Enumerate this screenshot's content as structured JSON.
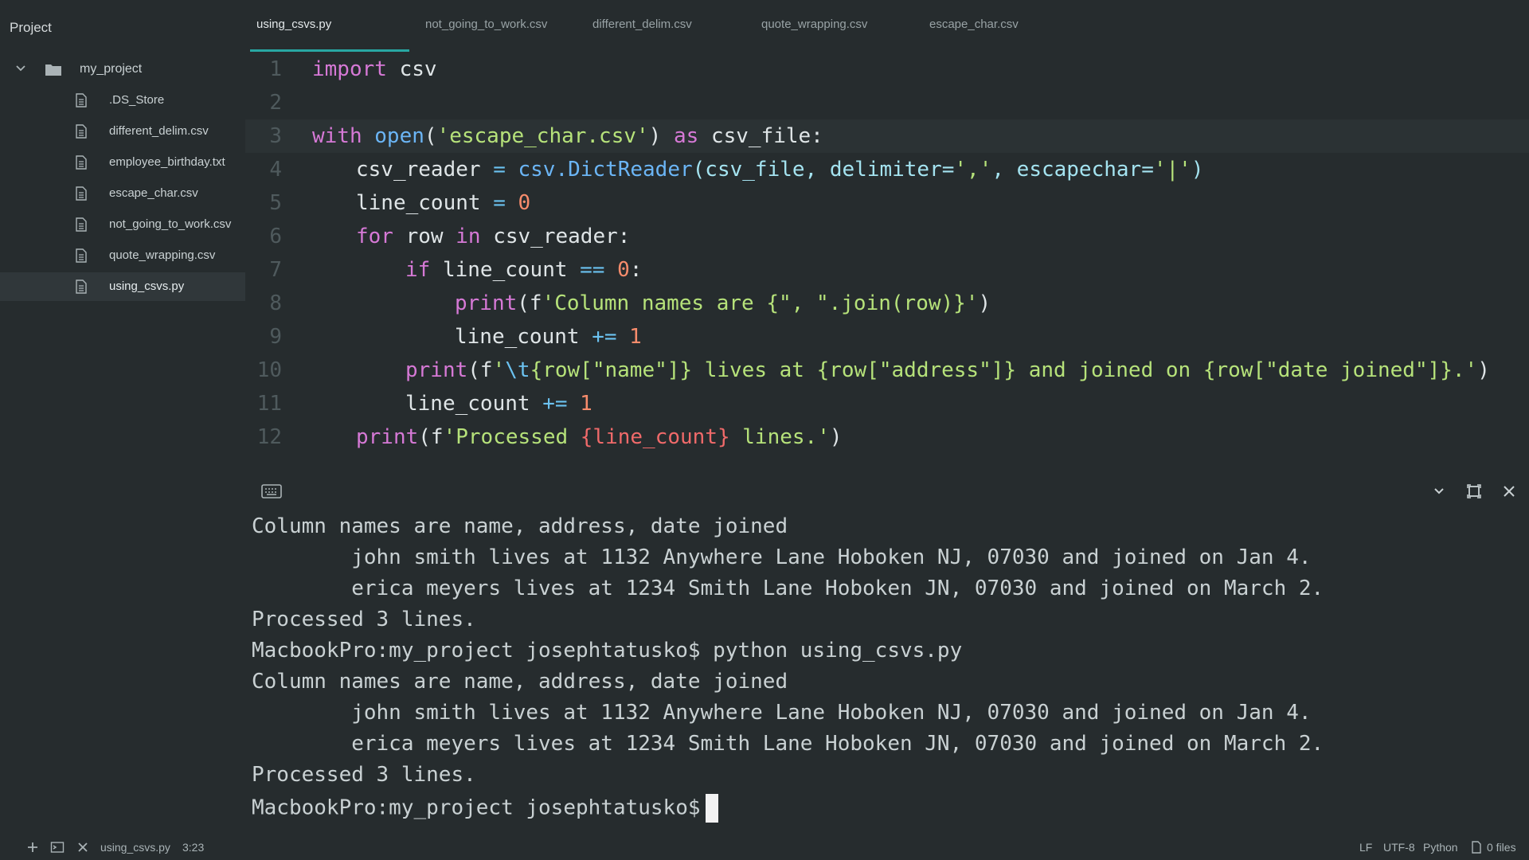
{
  "sidebar": {
    "title": "Project",
    "root_folder": "my_project",
    "files": [
      {
        "label": ".DS_Store",
        "active": false
      },
      {
        "label": "different_delim.csv",
        "active": false
      },
      {
        "label": "employee_birthday.txt",
        "active": false
      },
      {
        "label": "escape_char.csv",
        "active": false
      },
      {
        "label": "not_going_to_work.csv",
        "active": false
      },
      {
        "label": "quote_wrapping.csv",
        "active": false
      },
      {
        "label": "using_csvs.py",
        "active": true
      }
    ]
  },
  "tabs": [
    {
      "label": "using_csvs.py",
      "active": true
    },
    {
      "label": "not_going_to_work.csv",
      "active": false
    },
    {
      "label": "different_delim.csv",
      "active": false
    },
    {
      "label": "quote_wrapping.csv",
      "active": false
    },
    {
      "label": "escape_char.csv",
      "active": false
    }
  ],
  "editor": {
    "line_numbers": [
      "1",
      "2",
      "3",
      "4",
      "5",
      "6",
      "7",
      "8",
      "9",
      "10",
      "11",
      "12"
    ],
    "lines": [
      [
        [
          "kw",
          "import"
        ],
        [
          "pl",
          " csv"
        ]
      ],
      [],
      [
        [
          "kw",
          "with"
        ],
        [
          "pl",
          " "
        ],
        [
          "fn",
          "open"
        ],
        [
          "pl",
          "("
        ],
        [
          "str",
          "'escape_char.csv'"
        ],
        [
          "pl",
          ") "
        ],
        [
          "kw",
          "as"
        ],
        [
          "pl",
          " csv_file:"
        ]
      ],
      [
        [
          "pl",
          "csv_reader "
        ],
        [
          "op",
          "="
        ],
        [
          "pl",
          " "
        ],
        [
          "fn",
          "csv.DictReader"
        ],
        [
          "pr",
          "(csv_file, delimiter="
        ],
        [
          "str",
          "','"
        ],
        [
          "pr",
          ", escapechar="
        ],
        [
          "str",
          "'|'"
        ],
        [
          "pr",
          ")"
        ]
      ],
      [
        [
          "pl",
          "line_count "
        ],
        [
          "op",
          "="
        ],
        [
          "pl",
          " "
        ],
        [
          "num",
          "0"
        ]
      ],
      [
        [
          "kw",
          "for"
        ],
        [
          "pl",
          " row "
        ],
        [
          "kw",
          "in"
        ],
        [
          "pl",
          " csv_reader:"
        ]
      ],
      [
        [
          "kw",
          "if"
        ],
        [
          "pl",
          " line_count "
        ],
        [
          "op",
          "=="
        ],
        [
          "pl",
          " "
        ],
        [
          "num",
          "0"
        ],
        [
          "pl",
          ":"
        ]
      ],
      [
        [
          "kw",
          "print"
        ],
        [
          "pl",
          "(f"
        ],
        [
          "str",
          "'Column names are {\", \".join(row)}'"
        ],
        [
          "pl",
          ")"
        ]
      ],
      [
        [
          "pl",
          "line_count "
        ],
        [
          "op",
          "+="
        ],
        [
          "pl",
          " "
        ],
        [
          "num",
          "1"
        ]
      ],
      [
        [
          "kw",
          "print"
        ],
        [
          "pl",
          "(f"
        ],
        [
          "str",
          "'"
        ],
        [
          "op",
          "\\t"
        ],
        [
          "str",
          "{row[\"name\"]} lives at {row[\"address\"]} and joined on {row[\"date joined\"]}.'"
        ],
        [
          "pl",
          ")"
        ]
      ],
      [
        [
          "pl",
          "line_count "
        ],
        [
          "op",
          "+="
        ],
        [
          "pl",
          " "
        ],
        [
          "num",
          "1"
        ]
      ],
      [
        [
          "kw",
          "print"
        ],
        [
          "pl",
          "(f"
        ],
        [
          "str",
          "'Processed "
        ],
        [
          "interp",
          "{line_count}"
        ],
        [
          "str",
          " lines.'"
        ],
        [
          "pl",
          ")"
        ]
      ]
    ],
    "current_line": 3
  },
  "terminal": {
    "lines": [
      "Column names are name, address, date joined",
      "        john smith lives at 1132 Anywhere Lane Hoboken NJ, 07030 and joined on Jan 4.",
      "        erica meyers lives at 1234 Smith Lane Hoboken JN, 07030 and joined on March 2.",
      "Processed 3 lines.",
      "MacbookPro:my_project josephtatusko$ python using_csvs.py",
      "Column names are name, address, date joined",
      "        john smith lives at 1132 Anywhere Lane Hoboken NJ, 07030 and joined on Jan 4.",
      "        erica meyers lives at 1234 Smith Lane Hoboken JN, 07030 and joined on March 2.",
      "Processed 3 lines."
    ],
    "prompt": "MacbookPro:my_project josephtatusko$"
  },
  "statusbar": {
    "filename": "using_csvs.py",
    "cursor_pos": "3:23",
    "line_ending": "LF",
    "encoding": "UTF-8",
    "language": "Python",
    "files": "0 files"
  },
  "colors": {
    "accent": "#28a7a3",
    "background": "#262c2e",
    "keyword": "#d679d6",
    "string": "#b6e27a",
    "number": "#f78c6c"
  }
}
